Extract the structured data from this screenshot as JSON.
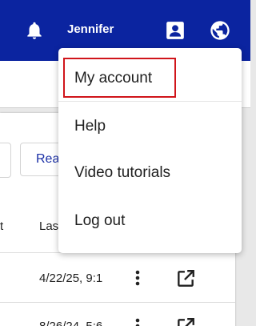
{
  "appbar": {
    "user_name": "Jennifer",
    "background": "#0b24a0"
  },
  "toolbar": {
    "read_button_label": "Rea"
  },
  "table": {
    "columns": [
      "t",
      "Las"
    ],
    "rows": [
      {
        "date": "4/22/25, 9:1"
      },
      {
        "date": "8/26/24, 5:6"
      }
    ]
  },
  "menu": {
    "items": [
      {
        "label": "My account"
      },
      {
        "label": "Help"
      },
      {
        "label": "Video tutorials"
      },
      {
        "label": "Log out"
      }
    ],
    "highlight_color": "#d0151b"
  },
  "icons": {
    "bell": "bell-icon",
    "contact": "contact-card-icon",
    "globe": "globe-icon",
    "kebab": "more-vert-icon",
    "open": "open-in-new-icon"
  }
}
